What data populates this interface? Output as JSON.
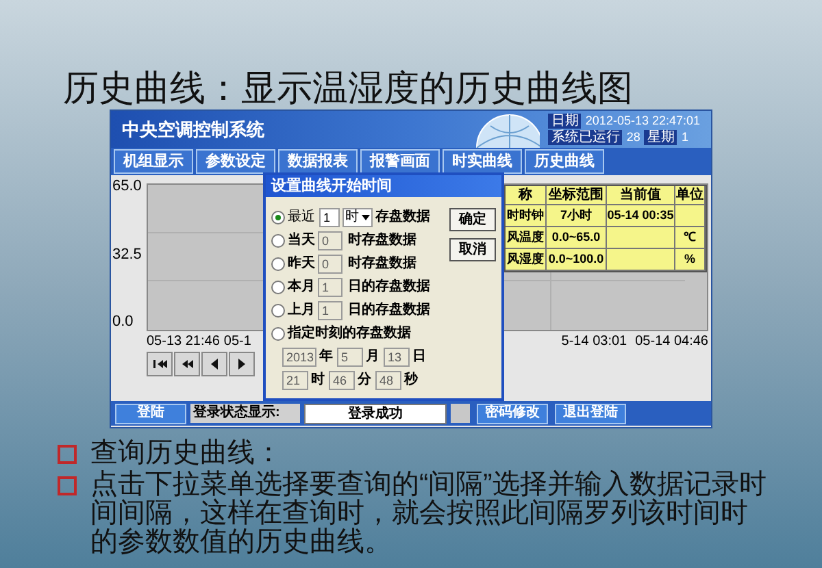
{
  "slide": {
    "title": "历史曲线：显示温湿度的历史曲线图",
    "bullets": [
      "查询历史曲线：",
      "点击下拉菜单选择要查询的“间隔”选择并输入数据记录时间间隔，这样在查询时，就会按照此间隔罗列该时间时的参数数值的历史曲线。"
    ]
  },
  "app": {
    "title": "中央空调控制系统",
    "info": [
      [
        {
          "label": "日期",
          "value": "2012-05-13 22:47:01"
        }
      ],
      [
        {
          "label": "系统已运行",
          "value": "28"
        },
        {
          "label": "星期",
          "value": "1"
        }
      ]
    ],
    "tabs": [
      "机组显示",
      "参数设定",
      "数据报表",
      "报警画面",
      "时实曲线",
      "历史曲线"
    ],
    "chart": {
      "y_labels": [
        "65.0",
        "32.5",
        "0.0"
      ],
      "x_labels_left": [
        "05-13 21:46",
        "05-1"
      ],
      "x_labels_right": [
        "5-14 03:01",
        "05-14 04:46"
      ]
    },
    "table": {
      "columns": [
        "称",
        "坐标范围",
        "当前值",
        "单位"
      ],
      "rows": [
        {
          "name": "时时钟",
          "range": "7小时",
          "current": "05-14 00:35"
        },
        {
          "name": "风温度",
          "range": "0.0~65.0",
          "unit": "℃"
        },
        {
          "name": "风湿度",
          "range": "0.0~100.0",
          "unit": "%"
        }
      ]
    },
    "status_bar": {
      "login_button": "登陆",
      "status_label": "登录状态显示:",
      "status_value": "登录成功",
      "buttons": [
        "密码修改",
        "退出登陆"
      ]
    },
    "dialog": {
      "title": "设置曲线开始时间",
      "options": [
        {
          "kind": "dropdown",
          "label": "最近",
          "value": "1",
          "unit": "时",
          "suffix": "存盘数据",
          "selected": true
        },
        {
          "kind": "input",
          "label": "当天",
          "value": "0",
          "suffix": "时存盘数据",
          "selected": false
        },
        {
          "kind": "input",
          "label": "昨天",
          "value": "0",
          "suffix": "时存盘数据",
          "selected": false
        },
        {
          "kind": "input",
          "label": "本月",
          "value": "1",
          "suffix": "日的存盘数据",
          "selected": false
        },
        {
          "kind": "input",
          "label": "上月",
          "value": "1",
          "suffix": "日的存盘数据",
          "selected": false
        },
        {
          "kind": "datetime",
          "label": "指定时刻的存盘数据",
          "selected": false,
          "fields": [
            [
              {
                "value": "2013",
                "unit": "年"
              },
              {
                "value": "5",
                "unit": "月"
              },
              {
                "value": "13",
                "unit": "日"
              }
            ],
            [
              {
                "value": "21",
                "unit": "时"
              },
              {
                "value": "46",
                "unit": "分"
              },
              {
                "value": "48",
                "unit": "秒"
              }
            ]
          ]
        }
      ],
      "buttons": [
        "确定",
        "取消"
      ]
    }
  }
}
